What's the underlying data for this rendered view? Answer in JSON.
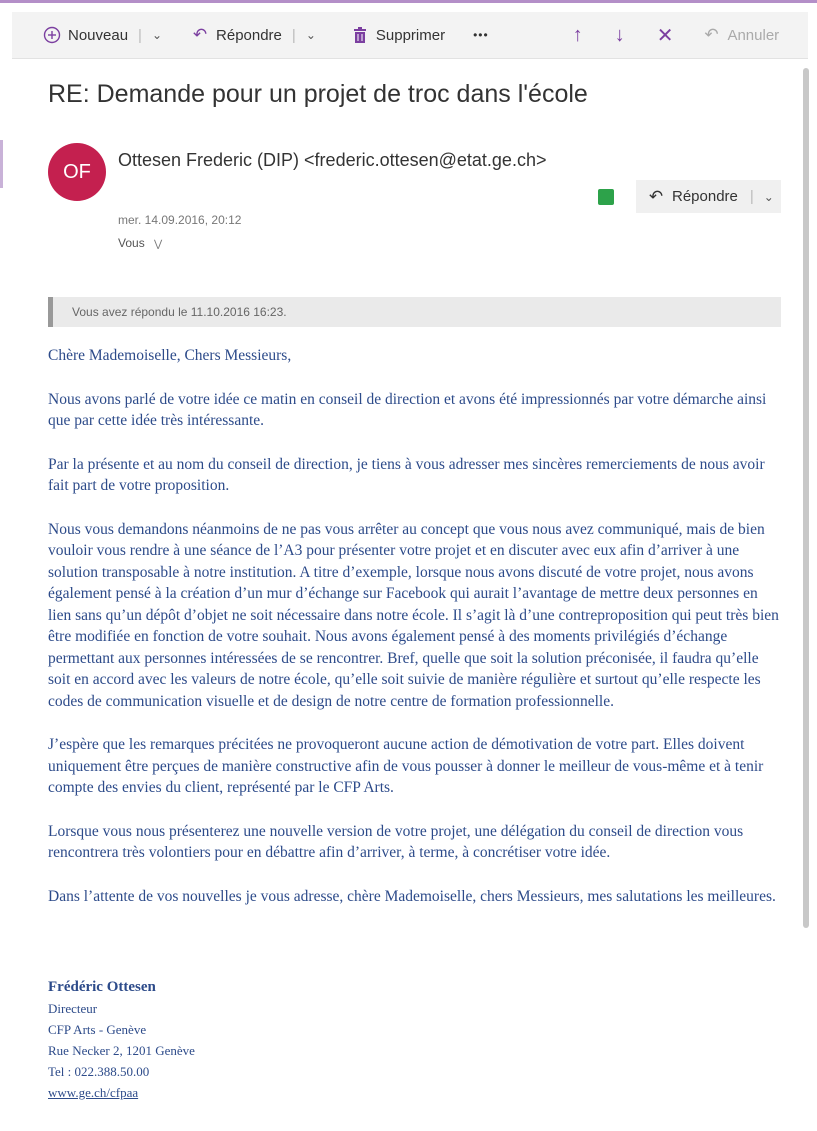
{
  "toolbar": {
    "new_label": "Nouveau",
    "reply_label": "Répondre",
    "delete_label": "Supprimer",
    "more_label": "•••",
    "undo_label": "Annuler"
  },
  "message": {
    "subject": "RE: Demande pour un projet de troc dans l'école",
    "avatar_initials": "OF",
    "sender": "Ottesen Frederic (DIP) <frederic.ottesen@etat.ge.ch>",
    "date": "mer. 14.09.2016, 20:12",
    "to": "Vous",
    "reply_button": "Répondre",
    "replied_notice": "Vous avez répondu le 11.10.2016 16:23."
  },
  "body": {
    "greeting": "Chère Mademoiselle, Chers Messieurs,",
    "p1": "Nous avons parlé de votre idée ce matin en conseil de direction et avons été impressionnés par votre démarche ainsi que par cette idée très intéressante.",
    "p2": "Par la présente et au nom du conseil de direction, je tiens à vous adresser mes sincères remerciements de nous avoir fait part de votre proposition.",
    "p3": "Nous vous demandons néanmoins de ne pas vous arrêter au concept que vous nous avez communiqué, mais de bien vouloir vous rendre à une séance de l’A3 pour présenter votre projet et en discuter avec eux afin d’arriver à une solution transposable à notre institution. A titre d’exemple, lorsque nous avons discuté de votre projet, nous avons également pensé à la création d’un mur d’échange sur Facebook qui aurait l’avantage de mettre deux personnes en lien sans qu’un dépôt d’objet ne soit nécessaire dans notre école. Il s’agit là d’une contreproposition qui peut très bien être modifiée en fonction de votre souhait. Nous avons également pensé à des moments privilégiés d’échange permettant aux personnes intéressées de se rencontrer. Bref, quelle que soit la solution préconisée, il faudra qu’elle soit en accord avec les valeurs de notre école, qu’elle soit suivie de manière régulière et surtout qu’elle respecte les codes de communication visuelle et de design de notre centre de formation professionnelle.",
    "p4": "J’espère que les remarques précitées ne provoqueront aucune action de démotivation de votre part. Elles doivent uniquement être perçues de manière constructive afin de vous pousser à donner le meilleur de vous-même et à tenir compte des envies du client, représenté par le CFP Arts.",
    "p5": "Lorsque vous nous présenterez une nouvelle version de votre projet, une délégation du conseil de direction vous rencontrera très volontiers pour en débattre afin d’arriver, à terme, à concrétiser votre idée.",
    "p6": "Dans l’attente de vos nouvelles je vous adresse, chère Mademoiselle, chers Messieurs, mes salutations les meilleures."
  },
  "signature": {
    "name": "Frédéric Ottesen",
    "title": "Directeur",
    "org": "CFP Arts - Genève",
    "address": "Rue Necker 2, 1201 Genève",
    "tel": "Tel : 022.388.50.00",
    "link": "www.ge.ch/cfpaa"
  }
}
